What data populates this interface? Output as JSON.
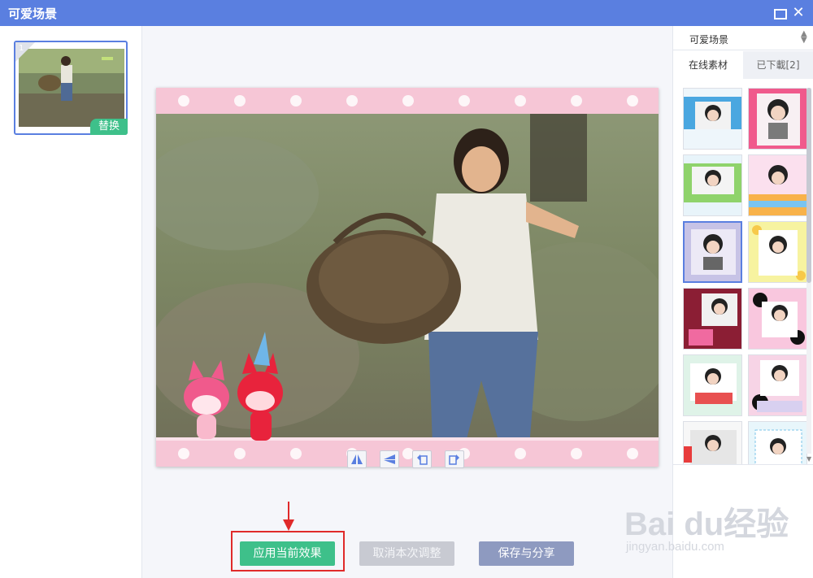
{
  "window": {
    "title": "可爱场景",
    "maximize_icon": "maximize-icon",
    "close_icon": "close-icon",
    "close_glyph": "✕"
  },
  "left_panel": {
    "thumbnail": {
      "index": "1",
      "replace_label": "替换"
    }
  },
  "editor": {
    "tools": [
      {
        "name": "flip-horizontal-icon"
      },
      {
        "name": "flip-vertical-icon"
      },
      {
        "name": "rotate-left-icon"
      },
      {
        "name": "rotate-right-icon"
      }
    ],
    "buttons": {
      "apply": "应用当前效果",
      "cancel": "取消本次调整",
      "save": "保存与分享"
    }
  },
  "right_panel": {
    "scene_select": {
      "value": "可爱场景"
    },
    "tabs": [
      {
        "label": "在线素材",
        "active": true
      },
      {
        "label": "已下載[2]",
        "active": false
      }
    ],
    "templates_count": 12
  },
  "watermark": {
    "logo": "Bai du经验",
    "url": "jingyan.baidu.com"
  },
  "colors": {
    "accent": "#5a7fe0",
    "apply_green": "#3ec08a",
    "highlight_red": "#e02a2a",
    "pink_border": "#f6c6d6"
  }
}
